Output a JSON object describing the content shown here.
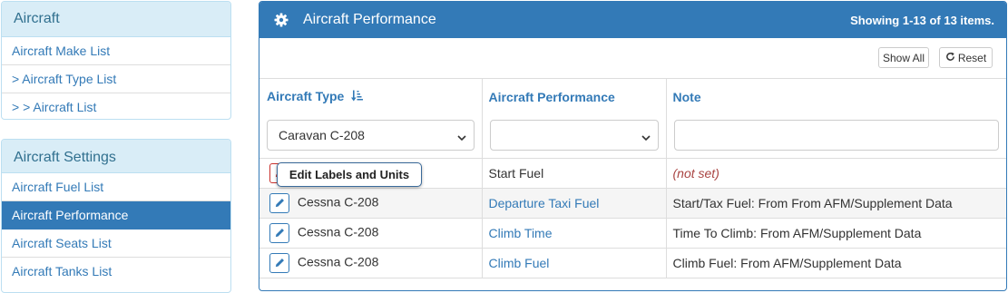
{
  "sidebar": {
    "aircraft": {
      "title": "Aircraft",
      "items": [
        "Aircraft Make List",
        "> Aircraft Type List",
        "> > Aircraft List"
      ]
    },
    "settings": {
      "title": "Aircraft Settings",
      "items": [
        "Aircraft Fuel List",
        "Aircraft Performance",
        "Aircraft Seats List",
        "Aircraft Tanks List"
      ],
      "active_item": "Aircraft Performance"
    }
  },
  "main": {
    "title": "Aircraft Performance",
    "summary": "Showing 1-13 of 13 items.",
    "toolbar": {
      "show_all_label": "Show All",
      "reset_label": "Reset"
    },
    "columns": [
      {
        "label": "Aircraft Type",
        "sorted": true,
        "sort_icon": "sort-amount-down-icon"
      },
      {
        "label": "Aircraft Performance"
      },
      {
        "label": "Note"
      }
    ],
    "filters": {
      "aircraft_type": "Caravan C-208",
      "performance": "",
      "note": ""
    },
    "tooltip": "Edit Labels and Units",
    "rows": [
      {
        "aircraft_type": "",
        "performance": "Start Fuel",
        "performance_link": false,
        "note": "(not set)",
        "note_not_set": true
      },
      {
        "aircraft_type": "Cessna C-208",
        "performance": "Departure Taxi Fuel",
        "performance_link": true,
        "note": "Start/Tax Fuel: From From AFM/Supplement Data"
      },
      {
        "aircraft_type": "Cessna C-208",
        "performance": "Climb Time",
        "performance_link": true,
        "note": "Time To Climb: From AFM/Supplement Data"
      },
      {
        "aircraft_type": "Cessna C-208",
        "performance": "Climb Fuel",
        "performance_link": true,
        "note": "Climb Fuel: From AFM/Supplement Data"
      }
    ]
  },
  "colors": {
    "primary": "#337ab7",
    "panel_info_bg": "#d9edf7",
    "panel_info_text": "#31708f",
    "not_set": "#a94442",
    "stripe": "#f5f5f5"
  },
  "icons": {
    "header": "gear-icon",
    "row_action": "pencil-icon",
    "reset": "refresh-icon",
    "select": "chevron-down-icon"
  }
}
